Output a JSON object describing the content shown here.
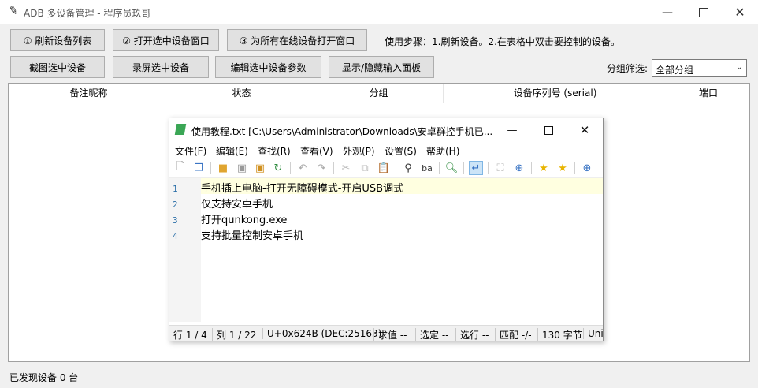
{
  "window": {
    "title": "ADB 多设备管理 - 程序员玖哥"
  },
  "toolbar": {
    "refresh": "① 刷新设备列表",
    "open_selected": "② 打开选中设备窗口",
    "open_all": "③ 为所有在线设备打开窗口",
    "steps": "使用步骤：1.刷新设备。2.在表格中双击要控制的设备。",
    "screenshot": "截图选中设备",
    "record": "录屏选中设备",
    "edit_params": "编辑选中设备参数",
    "toggle_input": "显示/隐藏输入面板",
    "filter_label": "分组筛选:",
    "filter_value": "全部分组"
  },
  "table": {
    "columns": [
      "备注昵称",
      "状态",
      "分组",
      "设备序列号 (serial)",
      "端口"
    ]
  },
  "status": {
    "text": "已发现设备 0 台"
  },
  "notepad": {
    "title": "使用教程.txt [C:\\Users\\Administrator\\Downloads\\安卓群控手机已...",
    "menu": [
      "文件(F)",
      "编辑(E)",
      "查找(R)",
      "查看(V)",
      "外观(P)",
      "设置(S)",
      "帮助(H)"
    ],
    "lines": [
      {
        "n": "1",
        "text": "手机插上电脑-打开无障碍模式-开启USB调式"
      },
      {
        "n": "2",
        "text": "仅支持安卓手机"
      },
      {
        "n": "3",
        "text": "打开qunkong.exe"
      },
      {
        "n": "4",
        "text": "支持批量控制安卓手机"
      }
    ],
    "status": [
      "行  1 / 4",
      "列  1 / 22",
      "U+0x624B (DEC:25163)",
      "求值  --",
      "选定  --",
      "选行  --",
      "匹配  -/-",
      "130 字节",
      "Uni"
    ]
  }
}
